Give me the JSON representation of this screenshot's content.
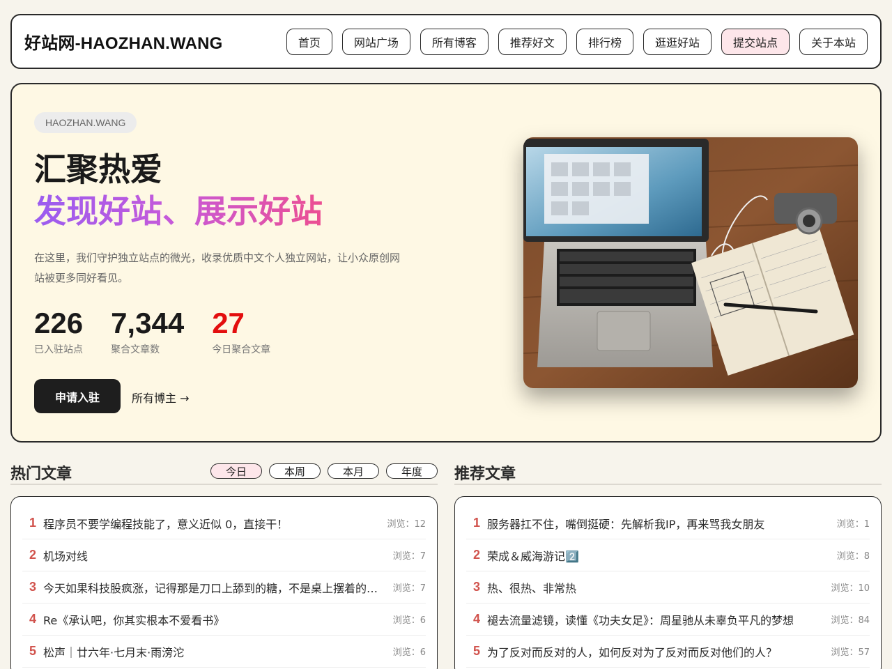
{
  "header": {
    "logo": "好站网-HAOZHAN.WANG",
    "nav": [
      {
        "label": "首页"
      },
      {
        "label": "网站广场"
      },
      {
        "label": "所有博客"
      },
      {
        "label": "推荐好文"
      },
      {
        "label": "排行榜"
      },
      {
        "label": "逛逛好站"
      },
      {
        "label": "提交站点",
        "active": true
      },
      {
        "label": "关于本站"
      }
    ]
  },
  "hero": {
    "badge": "HAOZHAN.WANG",
    "title_line1": "汇聚热爱",
    "title_line2": "发现好站、展示好站",
    "description": "在这里，我们守护独立站点的微光，收录优质中文个人独立网站，让小众原创网站被更多同好看见。",
    "stats": [
      {
        "value": "226",
        "label": "已入驻站点"
      },
      {
        "value": "7,344",
        "label": "聚合文章数"
      },
      {
        "value": "27",
        "label": "今日聚合文章",
        "highlight": "#e30e0e"
      }
    ],
    "primary_button": "申请入驻",
    "secondary_link": "所有博主 →",
    "image": "laptop-notebook-camera-photo"
  },
  "hot": {
    "title": "热门文章",
    "tabs": [
      {
        "label": "今日",
        "active": true
      },
      {
        "label": "本周"
      },
      {
        "label": "本月"
      },
      {
        "label": "年度"
      }
    ],
    "items": [
      {
        "rank": "1",
        "title": "程序员不要学编程技能了，意义近似 0，直接干！",
        "views": "浏览：12"
      },
      {
        "rank": "2",
        "title": "机场对线",
        "views": "浏览：7"
      },
      {
        "rank": "3",
        "title": "今天如果科技股疯涨，记得那是刀口上舔到的糖，不是桌上摆着的宴席",
        "views": "浏览：7"
      },
      {
        "rank": "4",
        "title": "Re《承认吧，你其实根本不爱看书》",
        "views": "浏览：6"
      },
      {
        "rank": "5",
        "title": "松声｜廿六年·七月末·雨滂沱",
        "views": "浏览：6"
      }
    ]
  },
  "recommended": {
    "title": "推荐文章",
    "items": [
      {
        "rank": "1",
        "title": "服务器扛不住，嘴倒挺硬：先解析我IP，再来骂我女朋友",
        "views": "浏览：1"
      },
      {
        "rank": "2",
        "title": "荣成＆威海游记2️⃣",
        "views": "浏览：8"
      },
      {
        "rank": "3",
        "title": "热、很热、非常热",
        "views": "浏览：10"
      },
      {
        "rank": "4",
        "title": "褪去流量滤镜，读懂《功夫女足》：周星驰从未辜负平凡的梦想",
        "views": "浏览：84"
      },
      {
        "rank": "5",
        "title": "为了反对而反对的人，如何反对为了反对而反对他们的人？",
        "views": "浏览：57"
      }
    ]
  }
}
